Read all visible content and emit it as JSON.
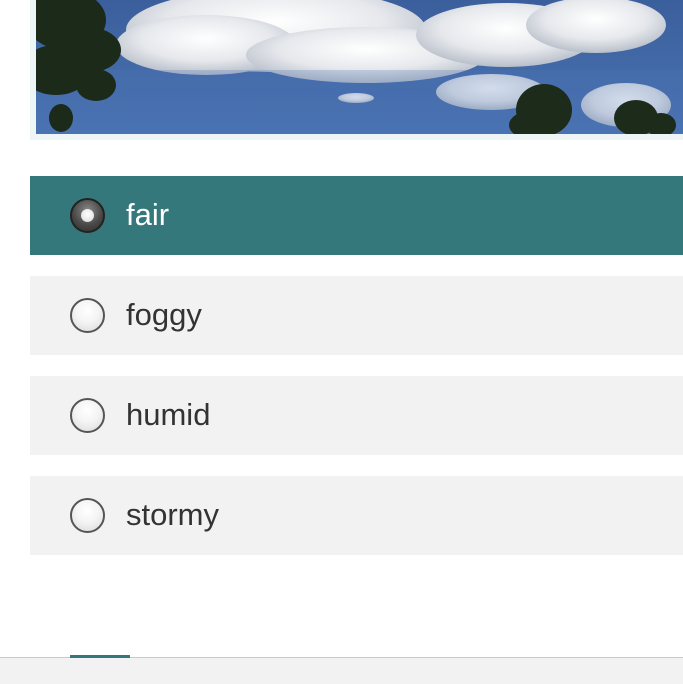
{
  "photo": {
    "icon": "sky-clouds-trees-photo"
  },
  "question": {
    "selected_index": 0,
    "options": [
      {
        "label": "fair",
        "selected": true
      },
      {
        "label": "foggy",
        "selected": false
      },
      {
        "label": "humid",
        "selected": false
      },
      {
        "label": "stormy",
        "selected": false
      }
    ]
  },
  "colors": {
    "accent": "#35787b",
    "option_bg": "#f2f2f2",
    "text": "#333333"
  }
}
